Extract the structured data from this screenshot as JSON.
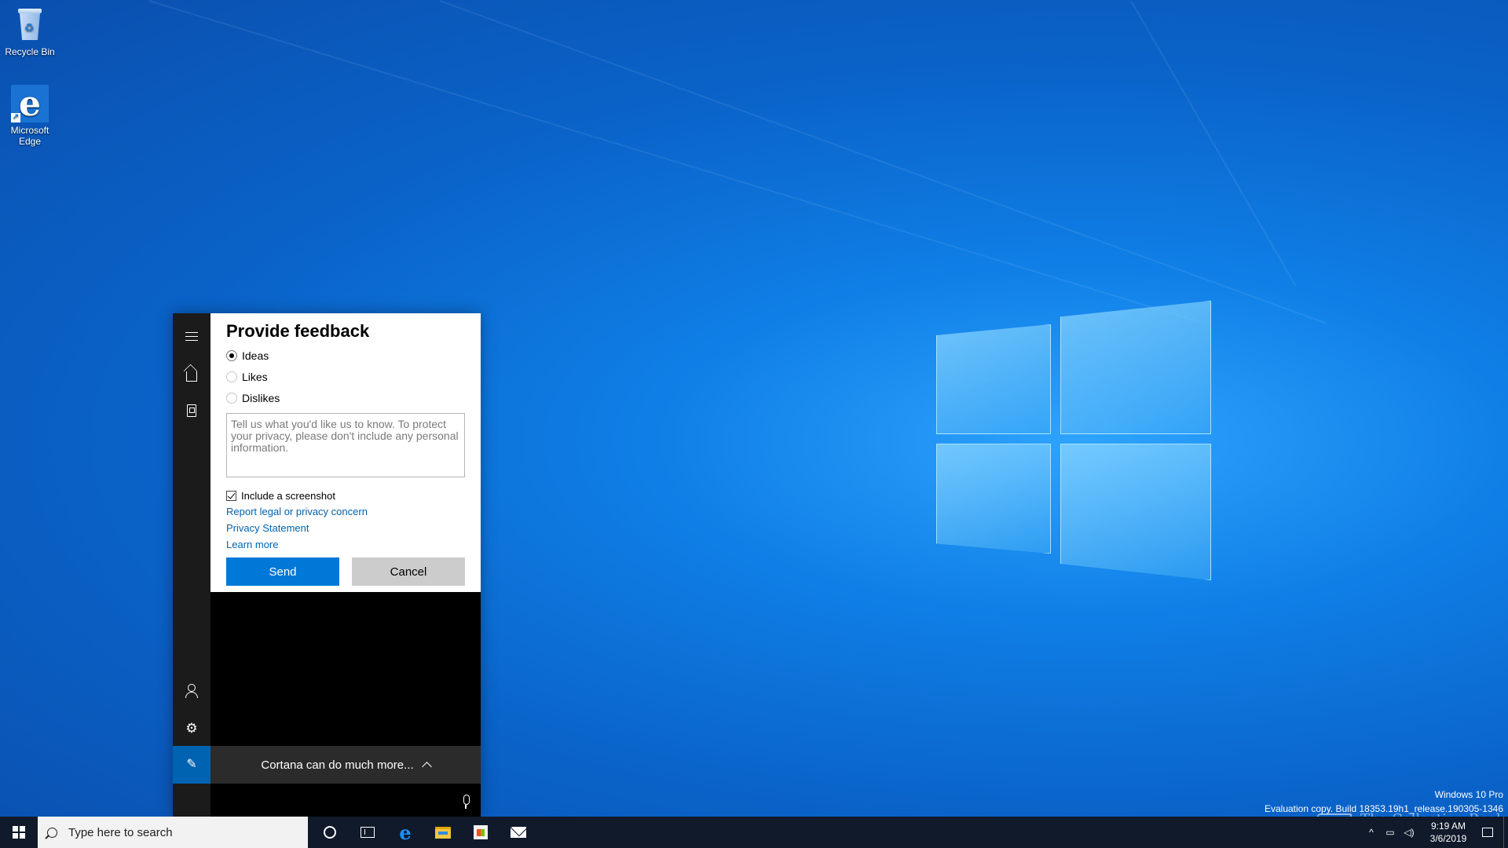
{
  "desktop": {
    "icons": [
      {
        "label": "Recycle Bin",
        "icon": "recycle-bin-icon"
      },
      {
        "label": "Microsoft Edge",
        "icon": "edge-icon"
      }
    ],
    "watermark": {
      "edition": "Windows 10 Pro",
      "build": "Evaluation copy. Build 18353.19h1_release.190305-1346",
      "site": "The Collection Book"
    }
  },
  "cortana": {
    "rail": {
      "menu": "hamburger-icon",
      "home": "home-icon",
      "notebook": "notebook-icon",
      "account": "person-icon",
      "settings": "gear-icon",
      "feedback": "feedback-icon"
    },
    "feedback": {
      "title": "Provide feedback",
      "options": [
        {
          "label": "Ideas",
          "selected": true
        },
        {
          "label": "Likes",
          "selected": false
        },
        {
          "label": "Dislikes",
          "selected": false
        }
      ],
      "textarea_placeholder": "Tell us what you'd like us to know. To protect your privacy, please don't include any personal information.",
      "screenshot_label": "Include a screenshot",
      "screenshot_checked": true,
      "links": {
        "legal": "Report legal or privacy concern",
        "privacy": "Privacy Statement",
        "learn": "Learn more"
      },
      "send_label": "Send",
      "cancel_label": "Cancel"
    },
    "more_label": "Cortana can do much more..."
  },
  "taskbar": {
    "search_placeholder": "Type here to search",
    "clock": {
      "time": "9:19 AM",
      "date": "3/6/2019"
    }
  },
  "colors": {
    "accent": "#0078d7",
    "link": "#0063b1",
    "rail": "#1b1b1b",
    "taskbar": "#101a2a"
  }
}
